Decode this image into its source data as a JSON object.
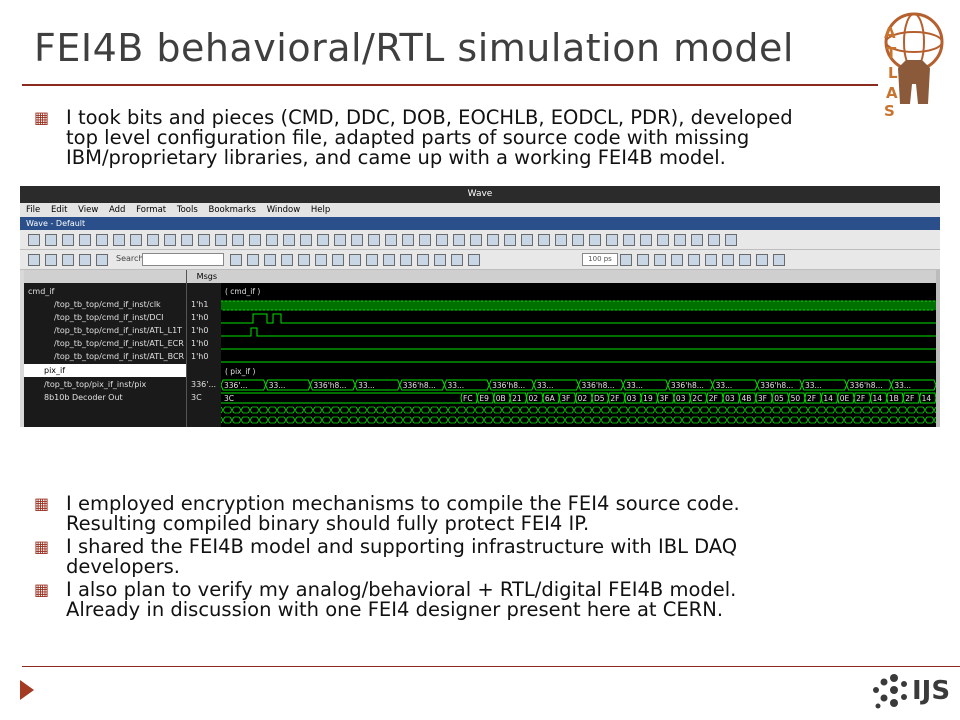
{
  "slide": {
    "title": "FEI4B behavioral/RTL simulation model",
    "bullets_top": [
      "I took bits and pieces (CMD, DDC, DOB, EOCHLB, EODCL, PDR), developed\ntop level configuration file, adapted parts of source code with missing\nIBM/proprietary libraries, and came up with a working FEI4B model."
    ],
    "bullets_bottom": [
      "I employed encryption mechanisms to compile the FEI4 source code.\nResulting compiled binary should fully protect FEI4 IP.",
      "I shared the FEI4B model and supporting infrastructure with IBL DAQ\ndevelopers.",
      "I also plan to verify my analog/behavioral + RTL/digital FEI4B model.\nAlready in discussion with one FEI4 designer present here at CERN."
    ],
    "logo_ijs": "IJS",
    "logo_atlas_letters": "ATLAS"
  },
  "wave": {
    "window_title": "Wave",
    "menu": [
      "File",
      "Edit",
      "View",
      "Add",
      "Format",
      "Tools",
      "Bookmarks",
      "Window",
      "Help"
    ],
    "subwindow_title": "Wave - Default",
    "search_label": "Search:",
    "zoom_value": "100 ps",
    "msgs_header": "Msgs",
    "signals": [
      {
        "name": "cmd_if",
        "value": ""
      },
      {
        "name": "/top_tb_top/cmd_if_inst/clk",
        "value": "1'h1"
      },
      {
        "name": "/top_tb_top/cmd_if_inst/DCI",
        "value": "1'h0"
      },
      {
        "name": "/top_tb_top/cmd_if_inst/ATL_L1T",
        "value": "1'h0"
      },
      {
        "name": "/top_tb_top/cmd_if_inst/ATL_ECR",
        "value": "1'h0"
      },
      {
        "name": "/top_tb_top/cmd_if_inst/ATL_BCR",
        "value": "1'h0"
      },
      {
        "name": "pix_if",
        "value": ""
      },
      {
        "name": "/top_tb_top/pix_if_inst/pix",
        "value": "336'..."
      },
      {
        "name": "8b10b Decoder Out",
        "value": "3C"
      }
    ],
    "group_cmd": "( cmd_if )",
    "group_pix": "( pix_if )",
    "pix_labels": [
      "336'...",
      "33...",
      "336'h8...",
      "33...",
      "336'h8...",
      "33...",
      "336'h8...",
      "33...",
      "336'h8...",
      "33...",
      "336'h8...",
      "33...",
      "336'h8...",
      "33...",
      "336'h8...",
      "33..."
    ],
    "dec_first": "3C",
    "dec_labels": [
      "FC",
      "E9",
      "0B",
      "21",
      "02",
      "6A",
      "3F",
      "02",
      "D5",
      "2F",
      "03",
      "19",
      "3F",
      "03",
      "2C",
      "2F",
      "03",
      "4B",
      "3F",
      "05",
      "50",
      "2F",
      "14",
      "0E",
      "2F",
      "14",
      "1B",
      "2F",
      "14"
    ],
    "colors": {
      "signal": "#00e000",
      "bus": "#00e000",
      "sel": "#ffffff"
    }
  }
}
